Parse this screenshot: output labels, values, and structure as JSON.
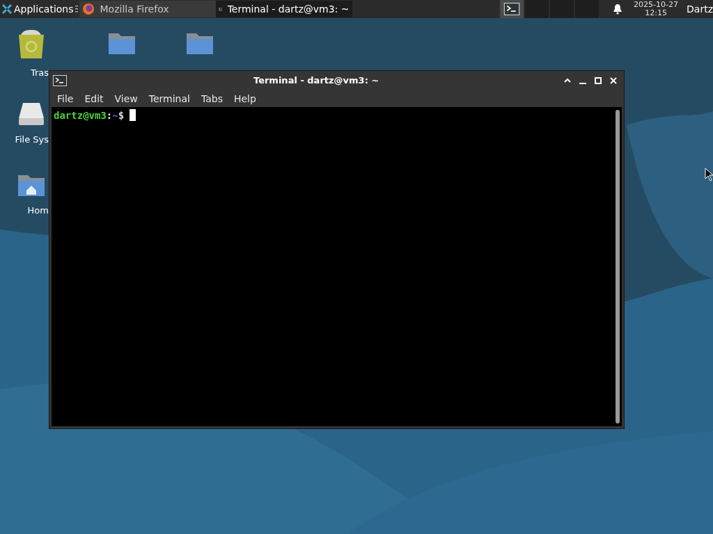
{
  "taskbar": {
    "apps_menu": {
      "label": "Applications"
    },
    "windows": [
      {
        "title": "Mozilla Firefox",
        "kind": "browser",
        "selected": false
      },
      {
        "title": "Terminal - dartz@vm3: ~",
        "kind": "terminal",
        "selected": true
      }
    ],
    "workspaces": [
      {
        "kind": "terminal",
        "selected": true
      },
      {
        "kind": "empty",
        "selected": false
      },
      {
        "kind": "empty",
        "selected": false
      },
      {
        "kind": "empty",
        "selected": false
      }
    ],
    "clock": {
      "date": "2025-10-27",
      "time": "12:15"
    },
    "user": "Dartz"
  },
  "desktop_icons": [
    {
      "kind": "trash",
      "label": "Tras"
    },
    {
      "kind": "folder"
    },
    {
      "kind": "folder"
    },
    {
      "kind": "drive",
      "label": "File Sys"
    },
    {
      "kind": "home",
      "label": "Hom"
    }
  ],
  "terminal": {
    "title": "Terminal - dartz@vm3: ~",
    "menu": [
      "File",
      "Edit",
      "View",
      "Terminal",
      "Tabs",
      "Help"
    ],
    "prompt": {
      "user_host": "dartz@vm3",
      "separator": ":",
      "path": "~",
      "symbol": "$"
    }
  }
}
